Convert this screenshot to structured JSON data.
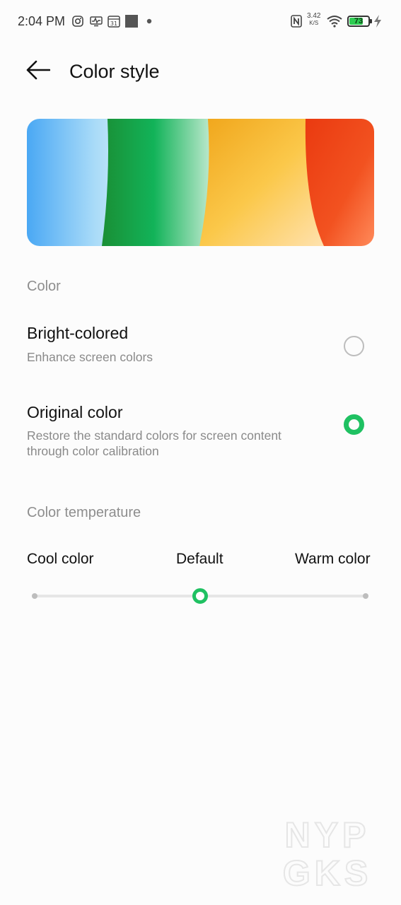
{
  "status_bar": {
    "time": "2:04 PM",
    "net_speed_value": "3.42",
    "net_speed_unit": "K/S",
    "battery_level": "73",
    "icons": [
      "instagram-icon",
      "activity-icon",
      "calendar-icon",
      "square-icon",
      "dot-icon",
      "nfc-icon",
      "wifi-icon",
      "battery-icon",
      "charging-icon"
    ],
    "calendar_day": "31"
  },
  "header": {
    "back_icon": "arrow-left-icon",
    "title": "Color style"
  },
  "color_section": {
    "label": "Color",
    "options": [
      {
        "title": "Bright-colored",
        "subtitle": "Enhance screen colors",
        "selected": false
      },
      {
        "title": "Original color",
        "subtitle": "Restore the standard colors for screen content through color calibration",
        "selected": true
      }
    ]
  },
  "temperature_section": {
    "label": "Color temperature",
    "cool_label": "Cool color",
    "default_label": "Default",
    "warm_label": "Warm color",
    "slider_value": 0.5
  },
  "colors": {
    "accent": "#1fc162",
    "secondary_text": "#8e8e8e",
    "background": "#fcfcfc"
  },
  "watermark": [
    "NYP",
    "GKS"
  ]
}
